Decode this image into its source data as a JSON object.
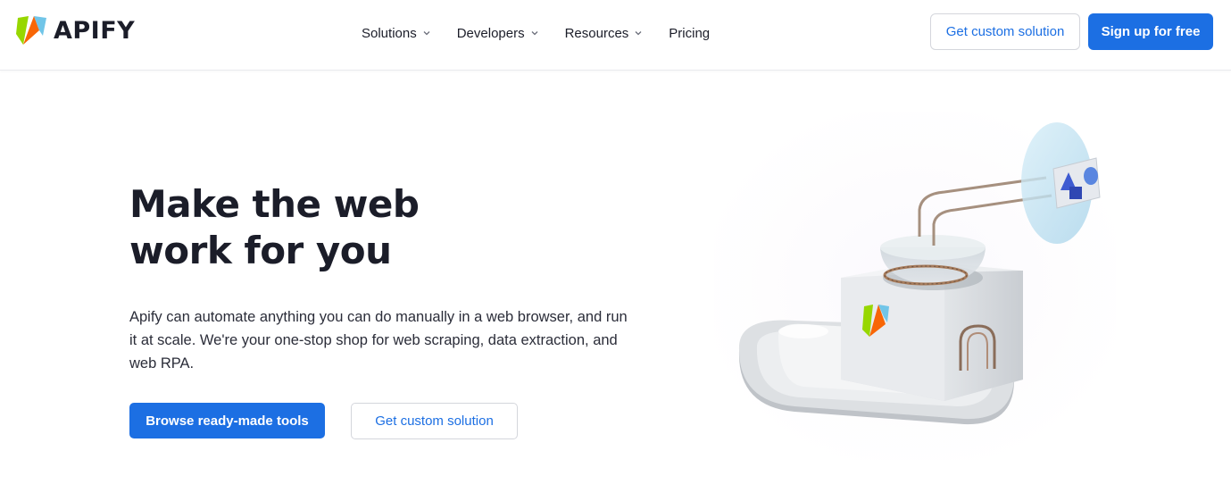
{
  "brand": {
    "name": "APIFY"
  },
  "nav": {
    "items": [
      {
        "label": "Solutions",
        "has_dropdown": true
      },
      {
        "label": "Developers",
        "has_dropdown": true
      },
      {
        "label": "Resources",
        "has_dropdown": true
      },
      {
        "label": "Pricing",
        "has_dropdown": false
      }
    ]
  },
  "header_actions": {
    "custom_solution_label": "Get custom solution",
    "signup_label": "Sign up for free"
  },
  "hero": {
    "title_line1": "Make the web",
    "title_line2": "work for you",
    "description": "Apify can automate anything you can do manually in a web browser, and run it at scale. We're your one-stop shop for web scraping, data extraction, and web RPA.",
    "primary_label": "Browse ready-made tools",
    "secondary_label": "Get custom solution"
  },
  "colors": {
    "accent": "#1c6fe3",
    "text": "#1b1d29",
    "logo_green": "#97d700",
    "logo_orange": "#f86606",
    "logo_blue": "#71c5e8"
  }
}
